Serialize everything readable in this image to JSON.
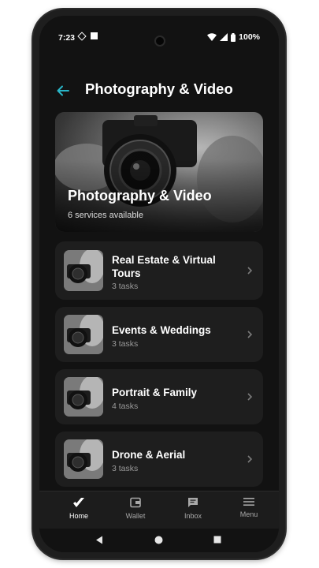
{
  "status_bar": {
    "time": "7:23",
    "battery_percent": "100%",
    "icons": [
      "vpn-diamond-icon",
      "notification-square-icon",
      "wifi-icon",
      "signal-icon",
      "battery-icon"
    ]
  },
  "header": {
    "title": "Photography & Video",
    "back_icon": "arrow-left-icon",
    "accent_color": "#29b6c8"
  },
  "hero": {
    "title": "Photography & Video",
    "subtitle": "6 services available",
    "image": "person-holding-camera-photo"
  },
  "services": [
    {
      "name": "Real Estate & Virtual Tours",
      "tasks": "3 tasks"
    },
    {
      "name": "Events & Weddings",
      "tasks": "3 tasks"
    },
    {
      "name": "Portrait & Family",
      "tasks": "4 tasks"
    },
    {
      "name": "Drone & Aerial",
      "tasks": "3 tasks"
    }
  ],
  "bottom_nav": {
    "items": [
      {
        "label": "Home",
        "icon": "home-logo-icon",
        "active": true
      },
      {
        "label": "Wallet",
        "icon": "wallet-icon",
        "active": false
      },
      {
        "label": "Inbox",
        "icon": "inbox-icon",
        "active": false
      },
      {
        "label": "Menu",
        "icon": "menu-icon",
        "active": false
      }
    ]
  },
  "system_nav": {
    "icons": [
      "back-triangle-icon",
      "home-circle-icon",
      "recents-square-icon"
    ]
  }
}
